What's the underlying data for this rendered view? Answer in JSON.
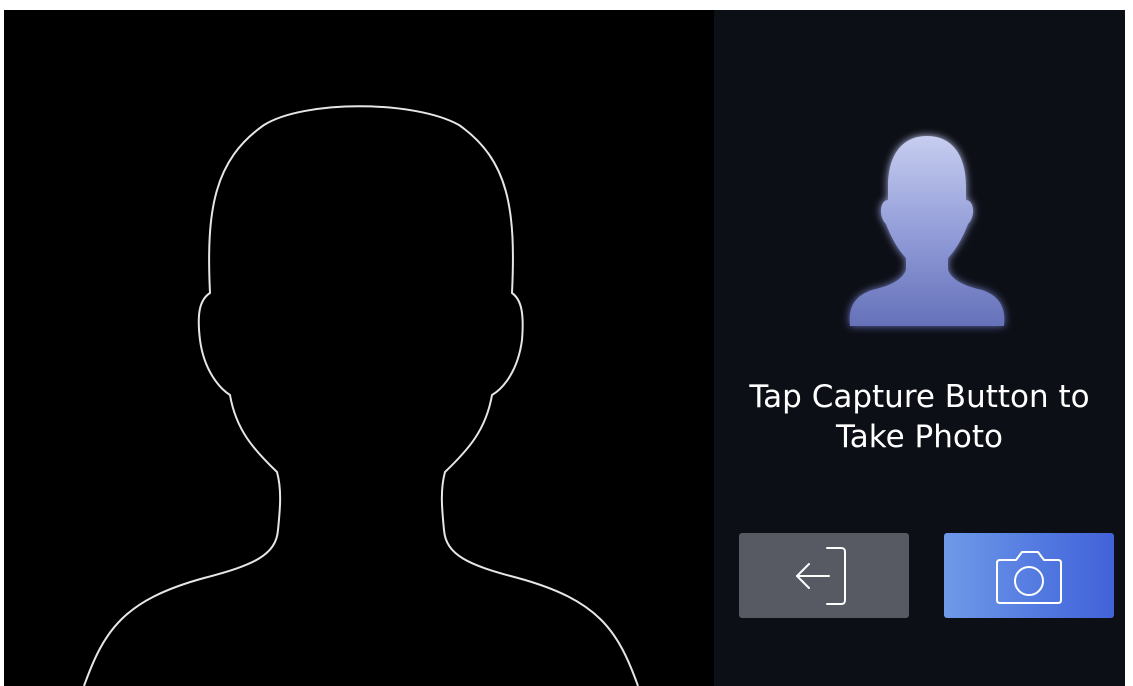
{
  "prompt": {
    "line1": "Tap Capture Button to",
    "line2": "Take Photo"
  },
  "buttons": {
    "exit_icon": "exit-arrow-icon",
    "capture_icon": "camera-icon"
  },
  "colors": {
    "camera_background": "#000000",
    "panel_background": "#0d0f17",
    "exit_button": "#575963",
    "capture_button_start": "#6f9ae8",
    "capture_button_end": "#4262d8",
    "outline": "#e6e6e6",
    "prompt_text": "#ffffff"
  }
}
